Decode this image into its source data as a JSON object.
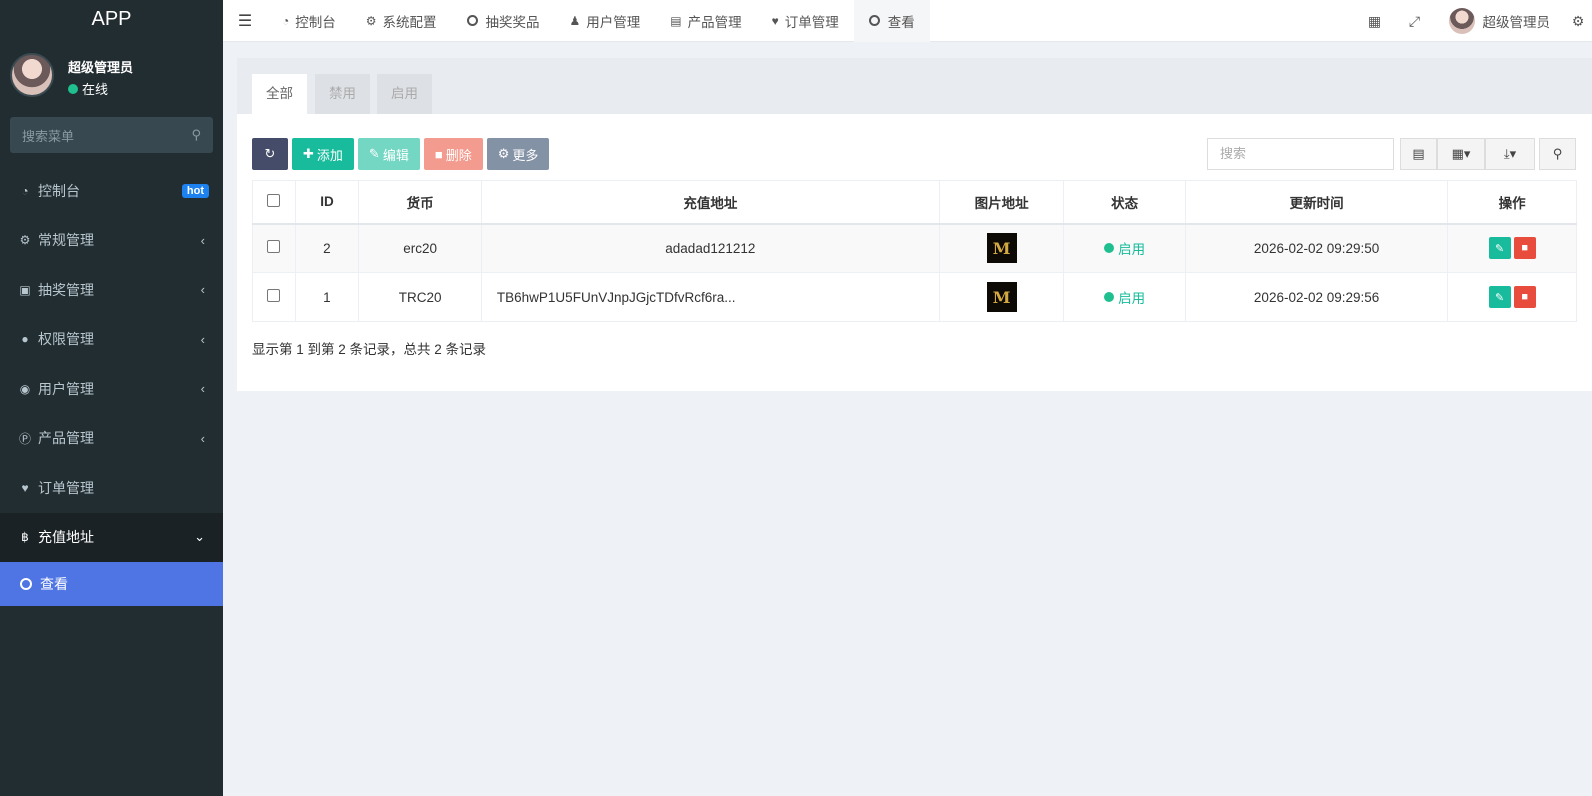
{
  "app": {
    "title": "APP"
  },
  "user": {
    "name": "超级管理员",
    "status": "在线"
  },
  "sidebar": {
    "search_placeholder": "搜索菜单",
    "items": [
      {
        "label": "控制台",
        "badge": "hot"
      },
      {
        "label": "常规管理"
      },
      {
        "label": "抽奖管理"
      },
      {
        "label": "权限管理"
      },
      {
        "label": "用户管理"
      },
      {
        "label": "产品管理"
      },
      {
        "label": "订单管理"
      },
      {
        "label": "充值地址"
      }
    ],
    "sub_item": "查看"
  },
  "topbar": {
    "tabs": [
      "控制台",
      "系统配置",
      "抽奖奖品",
      "用户管理",
      "产品管理",
      "订单管理",
      "查看"
    ],
    "user_name": "超级管理员"
  },
  "panel": {
    "tabs": [
      "全部",
      "禁用",
      "启用"
    ],
    "toolbar": {
      "add": "添加",
      "edit": "编辑",
      "delete": "删除",
      "more": "更多"
    },
    "search_placeholder": "搜索"
  },
  "table": {
    "headers": [
      "ID",
      "货币",
      "充值地址",
      "图片地址",
      "状态",
      "更新时间",
      "操作"
    ],
    "rows": [
      {
        "id": "2",
        "currency": "erc20",
        "address": "adadad121212",
        "thumb": "M",
        "status": "启用",
        "updated": "2026-02-02 09:29:50"
      },
      {
        "id": "1",
        "currency": "TRC20",
        "address": "TB6hwP1U5FUnVJnpJGjcTDfvRcf6ra...",
        "thumb": "M",
        "status": "启用",
        "updated": "2026-02-02 09:29:56"
      }
    ]
  },
  "footer": {
    "summary": "显示第 1 到第 2 条记录，总共 2 条记录"
  },
  "colors": {
    "sidebar_bg": "#222d32",
    "accent_green": "#18bc9c",
    "active_blue": "#4f75e4",
    "danger": "#e74c3c"
  }
}
